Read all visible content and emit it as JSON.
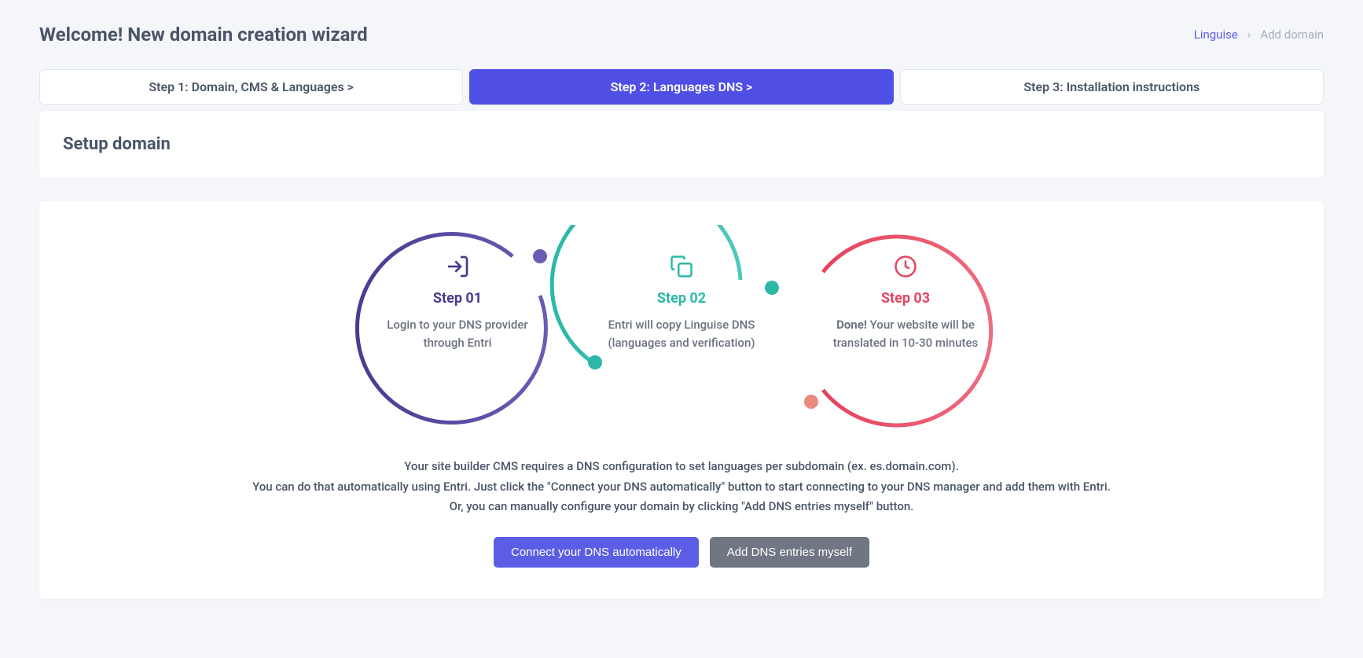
{
  "header": {
    "title": "Welcome! New domain creation wizard",
    "breadcrumb": {
      "root": "Linguise",
      "current": "Add domain"
    }
  },
  "tabs": {
    "step1": "Step 1: Domain, CMS & Languages  >",
    "step2": "Step 2: Languages DNS  >",
    "step3": "Step 3: Installation instructions"
  },
  "panel": {
    "title": "Setup domain"
  },
  "diagram": {
    "s1": {
      "label": "Step 01",
      "desc": "Login to your DNS provider through Entri"
    },
    "s2": {
      "label": "Step 02",
      "desc": "Entri will copy Linguise DNS (languages and verification)"
    },
    "s3": {
      "label": "Step 03",
      "bold": "Done!",
      "desc": " Your website will be translated in 10-30 minutes"
    }
  },
  "description": {
    "line1": "Your site builder CMS requires a DNS configuration to set languages per subdomain (ex. es.domain.com).",
    "line2": "You can do that automatically using Entri. Just click the \"Connect your DNS automatically\" button to start connecting to your DNS manager and add them with Entri.",
    "line3": "Or, you can manually configure your domain by clicking \"Add DNS entries myself\" button."
  },
  "buttons": {
    "primary": "Connect your DNS automatically",
    "secondary": "Add DNS entries myself"
  }
}
